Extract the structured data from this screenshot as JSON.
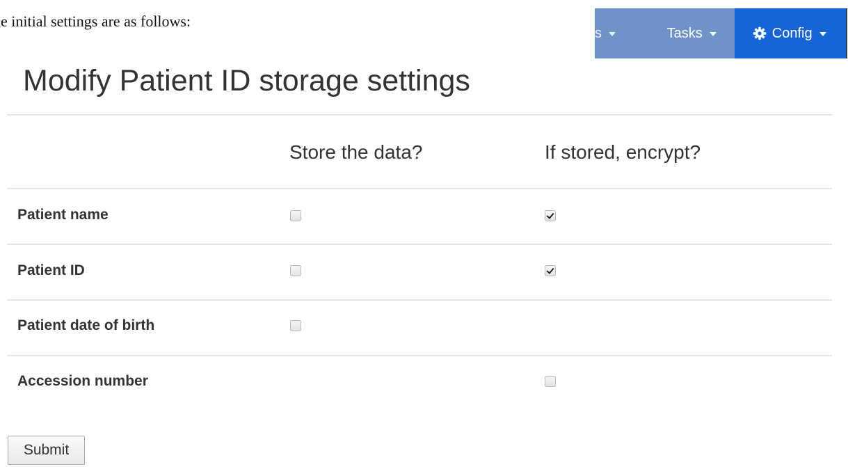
{
  "document": {
    "intro_text": "he initial settings are as follows:"
  },
  "navbar": {
    "items": [
      {
        "label": "s"
      },
      {
        "label": "Tasks"
      },
      {
        "label": "Config",
        "icon": "gear-icon",
        "active": true
      }
    ],
    "colors": {
      "bar": "#6f93c9",
      "active": "#1565d8"
    }
  },
  "page": {
    "title": "Modify Patient ID storage settings"
  },
  "table": {
    "columns": [
      "Store the data?",
      "If stored, encrypt?"
    ],
    "rows": [
      {
        "label": "Patient name",
        "store": false,
        "encrypt": true
      },
      {
        "label": "Patient ID",
        "store": false,
        "encrypt": true
      },
      {
        "label": "Patient date of birth",
        "store": false,
        "encrypt": null
      },
      {
        "label": "Accession number",
        "store": null,
        "encrypt": false
      }
    ]
  },
  "form": {
    "submit_label": "Submit"
  }
}
